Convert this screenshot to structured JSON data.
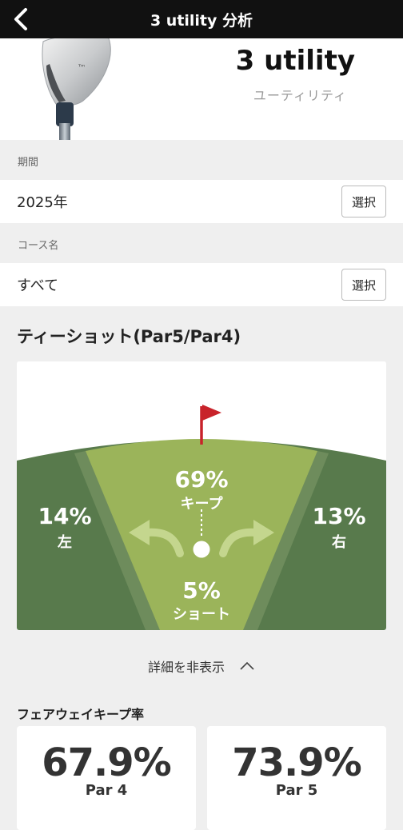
{
  "header": {
    "title": "3 utility 分析"
  },
  "club": {
    "name": "3 utility",
    "subtitle": "ユーティリティ"
  },
  "filters": {
    "period": {
      "label": "期間",
      "value": "2025年",
      "button": "選択"
    },
    "course": {
      "label": "コース名",
      "value": "すべて",
      "button": "選択"
    }
  },
  "tee_shot": {
    "title": "ティーショット(Par5/Par4)",
    "left": {
      "pct": "14%",
      "label": "左"
    },
    "keep": {
      "pct": "69%",
      "label": "キープ"
    },
    "right": {
      "pct": "13%",
      "label": "右"
    },
    "short": {
      "pct": "5%",
      "label": "ショート"
    }
  },
  "details_toggle": {
    "label": "詳細を非表示"
  },
  "fairway": {
    "title": "フェアウェイキープ率",
    "cards": [
      {
        "pct": "67.9%",
        "par": "Par 4"
      },
      {
        "pct": "73.9%",
        "par": "Par 5"
      }
    ]
  },
  "colors": {
    "rough": "#587a4c",
    "fairway": "#9bb45a",
    "fringe": "#6e8c5c",
    "arrow": "#c4d68e",
    "flag": "#c8232a"
  }
}
